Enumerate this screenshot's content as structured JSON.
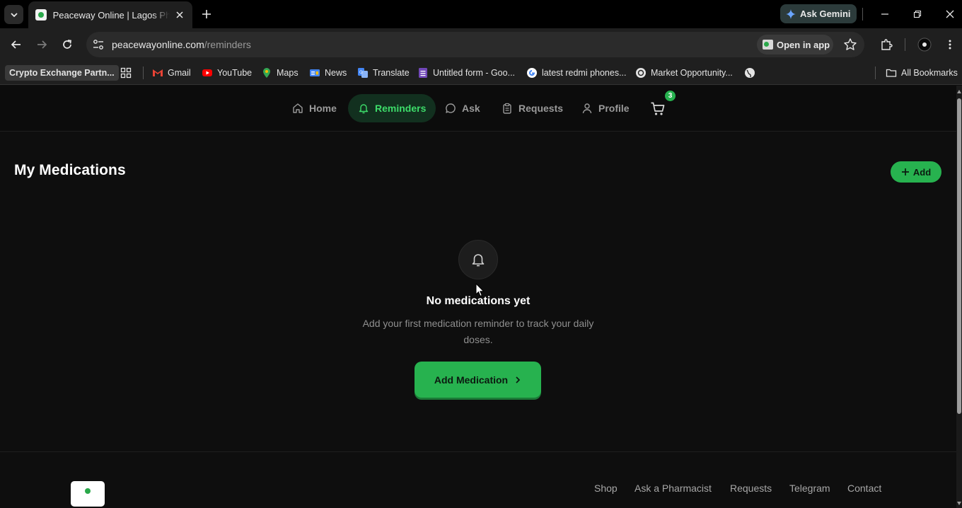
{
  "browser": {
    "tab": {
      "title": "Peaceway Online | Lagos Pharmacy"
    },
    "gemini_label": "Ask Gemini",
    "url": {
      "host": "peacewayonline.com",
      "path": "/reminders"
    },
    "open_in_app_label": "Open in app",
    "bookmarks": [
      {
        "label": "Crypto Exchange Partn...",
        "icon": "folder-chip"
      },
      {
        "label": "Gmail",
        "icon": "gmail-icon"
      },
      {
        "label": "YouTube",
        "icon": "youtube-icon"
      },
      {
        "label": "Maps",
        "icon": "maps-icon"
      },
      {
        "label": "News",
        "icon": "news-icon"
      },
      {
        "label": "Translate",
        "icon": "translate-icon"
      },
      {
        "label": "Untitled form - Goo...",
        "icon": "forms-icon"
      },
      {
        "label": "latest redmi phones...",
        "icon": "google-icon"
      },
      {
        "label": "Market Opportunity...",
        "icon": "chatgpt-icon"
      }
    ],
    "all_bookmarks_label": "All Bookmarks"
  },
  "app": {
    "nav": {
      "home": "Home",
      "reminders": "Reminders",
      "ask": "Ask",
      "requests": "Requests",
      "profile": "Profile",
      "cart_count": "3"
    },
    "page_title": "My Medications",
    "add_label": "Add",
    "empty": {
      "title": "No medications yet",
      "description": "Add your first medication reminder to track your daily doses.",
      "cta": "Add Medication"
    },
    "footer_links": {
      "shop": "Shop",
      "ask": "Ask a Pharmacist",
      "requests": "Requests",
      "telegram": "Telegram",
      "contact": "Contact"
    }
  },
  "colors": {
    "accent": "#27b24f",
    "accent_text": "#3ddc6a",
    "background": "#0e0e0e"
  }
}
